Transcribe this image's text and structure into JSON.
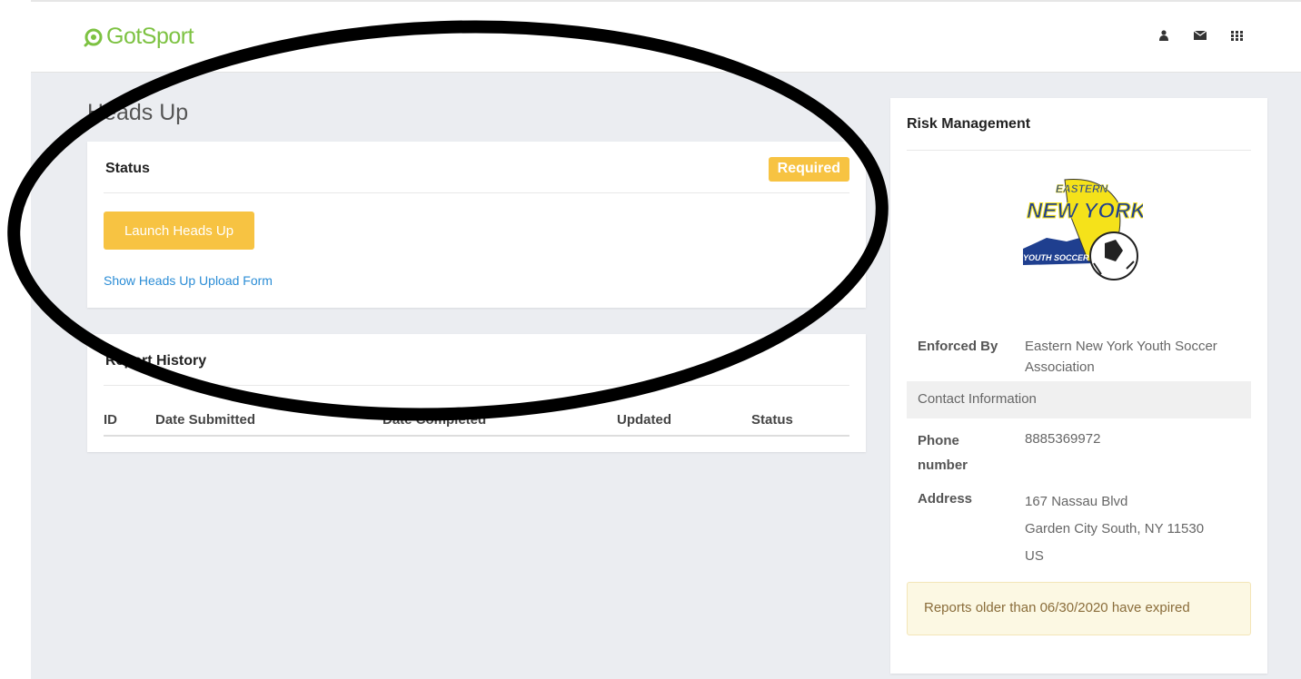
{
  "app": {
    "logo_text": "GotSport"
  },
  "nav": {
    "icons": [
      "user-icon",
      "envelope-icon",
      "apps-grid-icon"
    ]
  },
  "page": {
    "title": "Heads Up"
  },
  "status_card": {
    "title": "Status",
    "badge": "Required",
    "launch_label": "Launch Heads Up",
    "upload_link": "Show Heads Up Upload Form"
  },
  "history_card": {
    "title": "Report History",
    "columns": [
      "ID",
      "Date Submitted",
      "Date Completed",
      "Updated",
      "Status"
    ]
  },
  "risk": {
    "title": "Risk Management",
    "logo_alt": "Eastern New York Youth Soccer",
    "enforced_by_label": "Enforced By",
    "enforced_by_value": "Eastern New York Youth Soccer Association",
    "contact_heading": "Contact Information",
    "phone_label": "Phone number",
    "phone_value": "8885369972",
    "address_label": "Address",
    "address_line1": "167 Nassau Blvd",
    "address_line2": "Garden City South, NY 11530",
    "address_line3": "US",
    "alert": "Reports older than 06/30/2020 have expired"
  },
  "logo_art": {
    "line1": "EASTERN",
    "line2": "NEW YORK",
    "line3": "YOUTH SOCCER"
  },
  "colors": {
    "brand_green": "#7dc242",
    "warning_yellow": "#f7c342",
    "link_blue": "#2b8dd6",
    "page_bg": "#ebedf1"
  }
}
